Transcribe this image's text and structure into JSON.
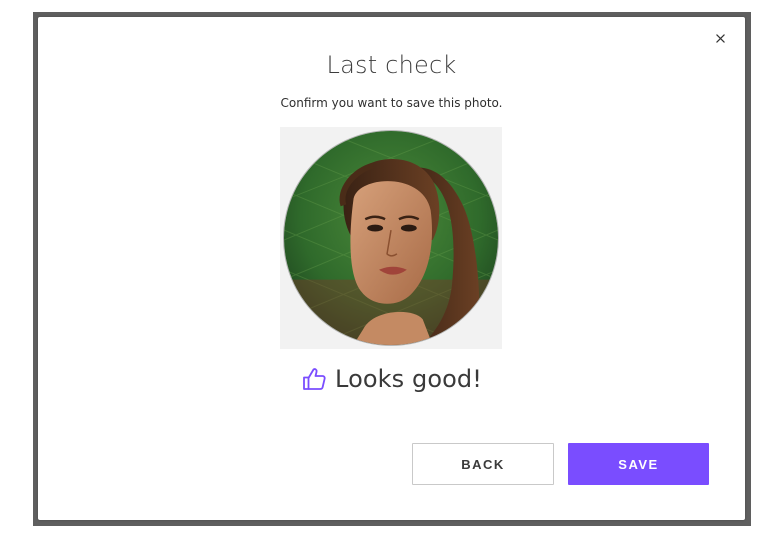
{
  "dialog": {
    "title": "Last check",
    "subtitle": "Confirm you want to save this photo.",
    "status_text": "Looks good!",
    "back_label": "BACK",
    "save_label": "SAVE",
    "close_glyph": "×"
  },
  "icons": {
    "close": "close-icon",
    "status": "thumbs-up-icon"
  },
  "colors": {
    "accent": "#7a4dff",
    "backdrop": "#5f5f5f"
  }
}
